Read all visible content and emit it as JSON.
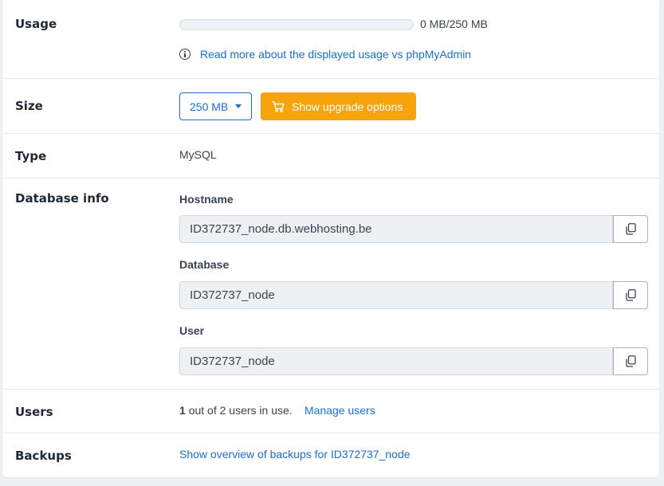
{
  "usage": {
    "label": "Usage",
    "used_fraction": 0,
    "text": "0 MB/250 MB",
    "info_icon": "info-circle-icon",
    "info_link": "Read more about the displayed usage vs phpMyAdmin"
  },
  "size": {
    "label": "Size",
    "selected": "250 MB",
    "upgrade_label": "Show upgrade options",
    "upgrade_icon": "cart-icon",
    "accent": "#1a6fd0",
    "upgrade_color": "#f7a30c"
  },
  "type": {
    "label": "Type",
    "value": "MySQL"
  },
  "database_info": {
    "label": "Database info",
    "fields": [
      {
        "label": "Hostname",
        "value": "ID372737_node.db.webhosting.be"
      },
      {
        "label": "Database",
        "value": "ID372737_node"
      },
      {
        "label": "User",
        "value": "ID372737_node"
      }
    ],
    "copy_icon": "copy-icon"
  },
  "users": {
    "label": "Users",
    "count": "1",
    "suffix": "out of 2 users in use.",
    "manage_link": "Manage users"
  },
  "backups": {
    "label": "Backups",
    "link": "Show overview of backups for ID372737_node"
  }
}
